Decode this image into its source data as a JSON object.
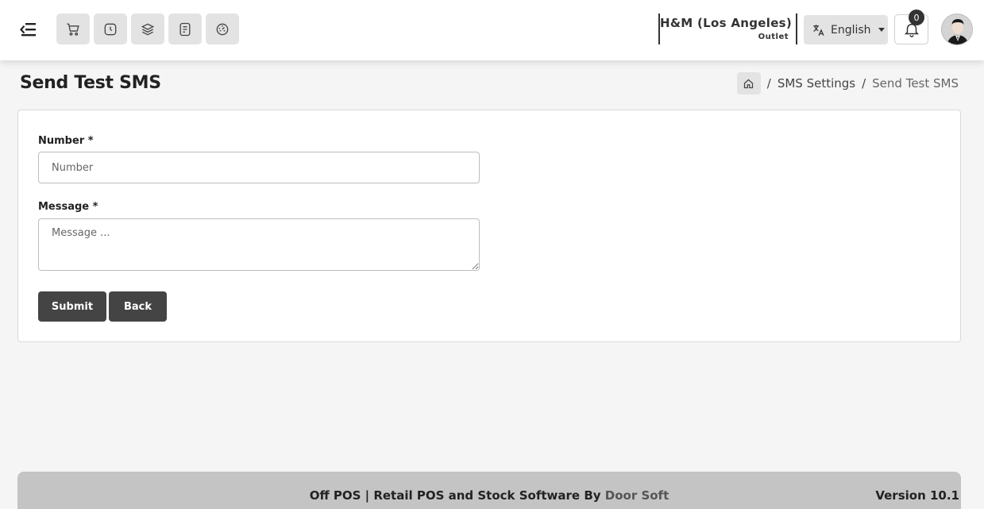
{
  "header": {
    "quick_icons": [
      "cart-icon",
      "clock-icon",
      "layers-icon",
      "receipt-icon",
      "dashboard-icon"
    ],
    "outlet_name": "H&M (Los Angeles)",
    "outlet_sub": "Outlet",
    "language": "English",
    "notification_count": "0"
  },
  "page": {
    "title": "Send Test SMS",
    "breadcrumb": [
      "SMS Settings",
      "Send Test SMS"
    ]
  },
  "form": {
    "number_label": "Number *",
    "number_placeholder": "Number",
    "number_value": "",
    "message_label": "Message *",
    "message_placeholder": "Message ...",
    "message_value": "",
    "submit_label": "Submit",
    "back_label": "Back"
  },
  "footer": {
    "text_prefix": "Off POS | Retail POS and Stock Software By ",
    "brand": "Door Soft",
    "version": "Version 10.1"
  },
  "colors": {
    "button_bg": "#444444",
    "icon_button_bg": "#e3e3e3",
    "footer_bg": "#c4c4c4"
  }
}
